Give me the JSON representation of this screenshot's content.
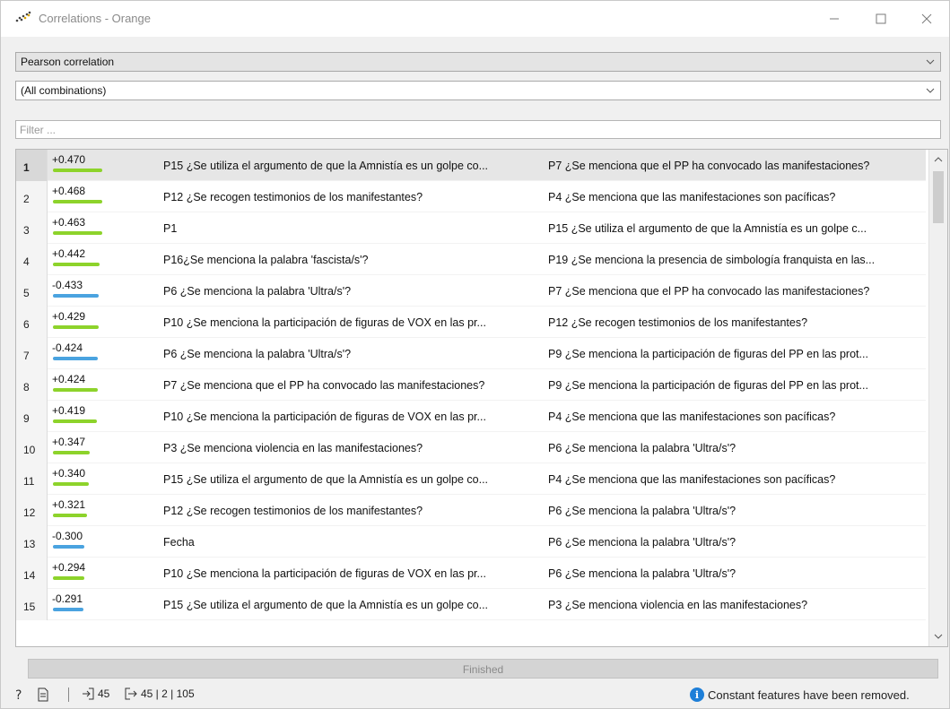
{
  "window": {
    "title": "Correlations - Orange",
    "minimize_icon": "minimize-icon",
    "maximize_icon": "maximize-icon",
    "close_icon": "close-icon"
  },
  "controls": {
    "method_value": "Pearson correlation",
    "features_value": "(All combinations)",
    "filter_placeholder": "Filter ...",
    "filter_value": ""
  },
  "colors": {
    "positive": "#8dd32b",
    "negative": "#4aa3e0",
    "selected_row": "#e6e6e6",
    "info_icon": "#1e7fd8"
  },
  "rows": [
    {
      "n": "1",
      "corr": "+0.470",
      "sign": "positive",
      "magnitude": 0.47,
      "a1": "P15 ¿Se utiliza el argumento de que la Amnistía es un golpe co...",
      "a2": "P7 ¿Se menciona que el PP ha convocado las manifestaciones?",
      "selected": true
    },
    {
      "n": "2",
      "corr": "+0.468",
      "sign": "positive",
      "magnitude": 0.468,
      "a1": "P12 ¿Se recogen testimonios de los manifestantes?",
      "a2": "P4 ¿Se menciona que las manifestaciones son pacíficas?"
    },
    {
      "n": "3",
      "corr": "+0.463",
      "sign": "positive",
      "magnitude": 0.463,
      "a1": "P1",
      "a2": "P15 ¿Se utiliza el argumento de que la Amnistía es un golpe c..."
    },
    {
      "n": "4",
      "corr": "+0.442",
      "sign": "positive",
      "magnitude": 0.442,
      "a1": "P16¿Se menciona la palabra 'fascista/s'?",
      "a2": "P19 ¿Se menciona la presencia de simbología franquista en las..."
    },
    {
      "n": "5",
      "corr": "-0.433",
      "sign": "negative",
      "magnitude": 0.433,
      "a1": "P6 ¿Se menciona la palabra 'Ultra/s'?",
      "a2": "P7 ¿Se menciona que el PP ha convocado las manifestaciones?"
    },
    {
      "n": "6",
      "corr": "+0.429",
      "sign": "positive",
      "magnitude": 0.429,
      "a1": "P10 ¿Se menciona la participación de figuras de VOX en las pr...",
      "a2": "P12 ¿Se recogen testimonios de los manifestantes?"
    },
    {
      "n": "7",
      "corr": "-0.424",
      "sign": "negative",
      "magnitude": 0.424,
      "a1": "P6 ¿Se menciona la palabra 'Ultra/s'?",
      "a2": "P9 ¿Se menciona la participación de figuras del PP en las prot..."
    },
    {
      "n": "8",
      "corr": "+0.424",
      "sign": "positive",
      "magnitude": 0.424,
      "a1": "P7 ¿Se menciona que el PP ha convocado las manifestaciones?",
      "a2": "P9 ¿Se menciona la participación de figuras del PP en las prot..."
    },
    {
      "n": "9",
      "corr": "+0.419",
      "sign": "positive",
      "magnitude": 0.419,
      "a1": "P10 ¿Se menciona la participación de figuras de VOX en las pr...",
      "a2": "P4 ¿Se menciona que las manifestaciones son pacíficas?"
    },
    {
      "n": "10",
      "corr": "+0.347",
      "sign": "positive",
      "magnitude": 0.347,
      "a1": "P3 ¿Se menciona violencia en las manifestaciones?",
      "a2": "P6 ¿Se menciona la palabra 'Ultra/s'?"
    },
    {
      "n": "11",
      "corr": "+0.340",
      "sign": "positive",
      "magnitude": 0.34,
      "a1": "P15 ¿Se utiliza el argumento de que la Amnistía es un golpe co...",
      "a2": "P4 ¿Se menciona que las manifestaciones son pacíficas?"
    },
    {
      "n": "12",
      "corr": "+0.321",
      "sign": "positive",
      "magnitude": 0.321,
      "a1": "P12 ¿Se recogen testimonios de los manifestantes?",
      "a2": "P6 ¿Se menciona la palabra 'Ultra/s'?"
    },
    {
      "n": "13",
      "corr": "-0.300",
      "sign": "negative",
      "magnitude": 0.3,
      "a1": "Fecha",
      "a2": "P6 ¿Se menciona la palabra 'Ultra/s'?"
    },
    {
      "n": "14",
      "corr": "+0.294",
      "sign": "positive",
      "magnitude": 0.294,
      "a1": "P10 ¿Se menciona la participación de figuras de VOX en las pr...",
      "a2": "P6 ¿Se menciona la palabra 'Ultra/s'?"
    },
    {
      "n": "15",
      "corr": "-0.291",
      "sign": "negative",
      "magnitude": 0.291,
      "a1": "P15 ¿Se utiliza el argumento de que la Amnistía es un golpe co...",
      "a2": "P3 ¿Se menciona violencia en las manifestaciones?"
    }
  ],
  "progress": {
    "text": "Finished"
  },
  "status": {
    "help_icon": "help-icon",
    "report_icon": "report-icon",
    "input_count": "45",
    "output_summary": "45 | 2 | 105",
    "message": "Constant features have been removed."
  }
}
